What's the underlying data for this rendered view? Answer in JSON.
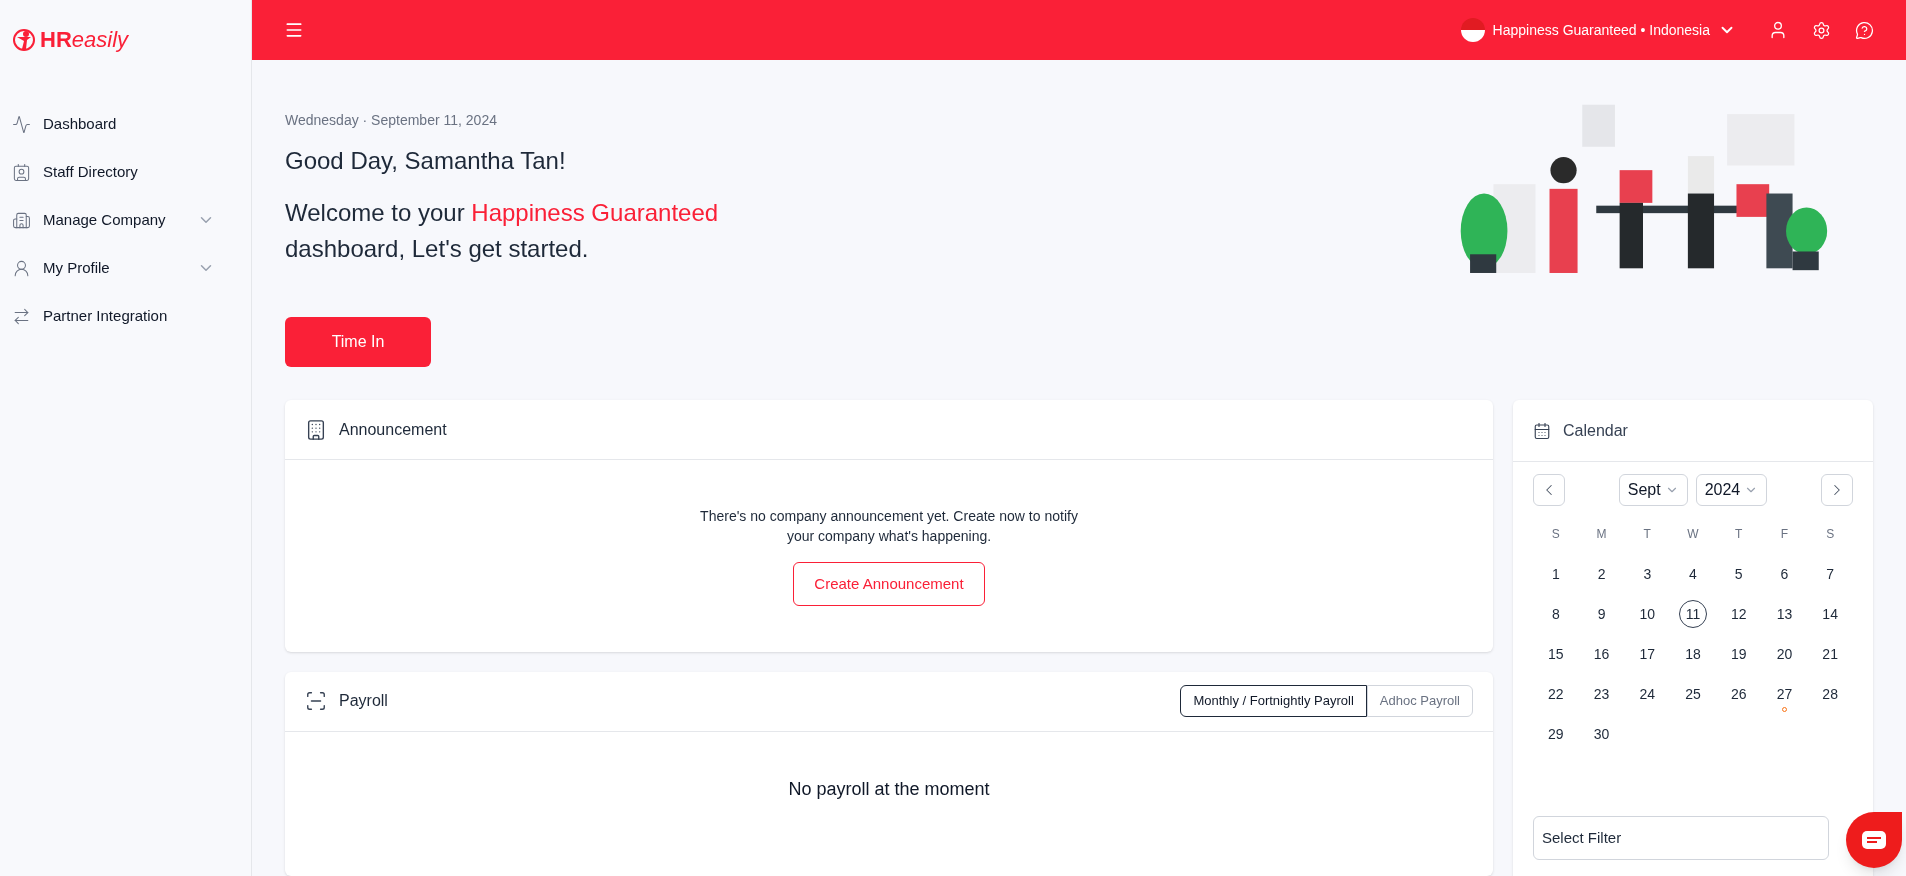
{
  "sidebar": {
    "logo": {
      "strong": "HR",
      "light": "easily"
    },
    "items": [
      {
        "label": "Dashboard",
        "expandable": false
      },
      {
        "label": "Staff Directory",
        "expandable": false
      },
      {
        "label": "Manage Company",
        "expandable": true
      },
      {
        "label": "My Profile",
        "expandable": true
      },
      {
        "label": "Partner Integration",
        "expandable": false
      }
    ]
  },
  "header": {
    "company": "Happiness Guaranteed • Indonesia"
  },
  "hero": {
    "date": "Wednesday · September 11, 2024",
    "greeting": "Good Day, Samantha Tan!",
    "welcome_prefix": "Welcome to your ",
    "welcome_company": "Happiness Guaranteed",
    "welcome_suffix": "dashboard, Let's get started."
  },
  "time_in_button": "Time In",
  "announcement": {
    "title": "Announcement",
    "empty_text": "There's no company announcement yet. Create now to notify your company what's happening.",
    "button": "Create Announcement"
  },
  "payroll": {
    "title": "Payroll",
    "tabs": [
      {
        "label": "Monthly / Fortnightly Payroll",
        "selected": true
      },
      {
        "label": "Adhoc Payroll",
        "selected": false
      }
    ],
    "empty_text": "No payroll at the moment"
  },
  "calendar": {
    "title": "Calendar",
    "month": "Sept",
    "year": "2024",
    "weekdays": [
      "S",
      "M",
      "T",
      "W",
      "T",
      "F",
      "S"
    ],
    "days": [
      {
        "label": "1",
        "selected": false,
        "event": false
      },
      {
        "label": "2",
        "selected": false,
        "event": false
      },
      {
        "label": "3",
        "selected": false,
        "event": false
      },
      {
        "label": "4",
        "selected": false,
        "event": false
      },
      {
        "label": "5",
        "selected": false,
        "event": false
      },
      {
        "label": "6",
        "selected": false,
        "event": false
      },
      {
        "label": "7",
        "selected": false,
        "event": false
      },
      {
        "label": "8",
        "selected": false,
        "event": false
      },
      {
        "label": "9",
        "selected": false,
        "event": false
      },
      {
        "label": "10",
        "selected": false,
        "event": false
      },
      {
        "label": "11",
        "selected": true,
        "event": false
      },
      {
        "label": "12",
        "selected": false,
        "event": false
      },
      {
        "label": "13",
        "selected": false,
        "event": false
      },
      {
        "label": "14",
        "selected": false,
        "event": false
      },
      {
        "label": "15",
        "selected": false,
        "event": false
      },
      {
        "label": "16",
        "selected": false,
        "event": false
      },
      {
        "label": "17",
        "selected": false,
        "event": false
      },
      {
        "label": "18",
        "selected": false,
        "event": false
      },
      {
        "label": "19",
        "selected": false,
        "event": false
      },
      {
        "label": "20",
        "selected": false,
        "event": false
      },
      {
        "label": "21",
        "selected": false,
        "event": false
      },
      {
        "label": "22",
        "selected": false,
        "event": false
      },
      {
        "label": "23",
        "selected": false,
        "event": false
      },
      {
        "label": "24",
        "selected": false,
        "event": false
      },
      {
        "label": "25",
        "selected": false,
        "event": false
      },
      {
        "label": "26",
        "selected": false,
        "event": false
      },
      {
        "label": "27",
        "selected": false,
        "event": true
      },
      {
        "label": "28",
        "selected": false,
        "event": false
      },
      {
        "label": "29",
        "selected": false,
        "event": false
      },
      {
        "label": "30",
        "selected": false,
        "event": false
      }
    ],
    "filter_placeholder": "Select Filter"
  }
}
